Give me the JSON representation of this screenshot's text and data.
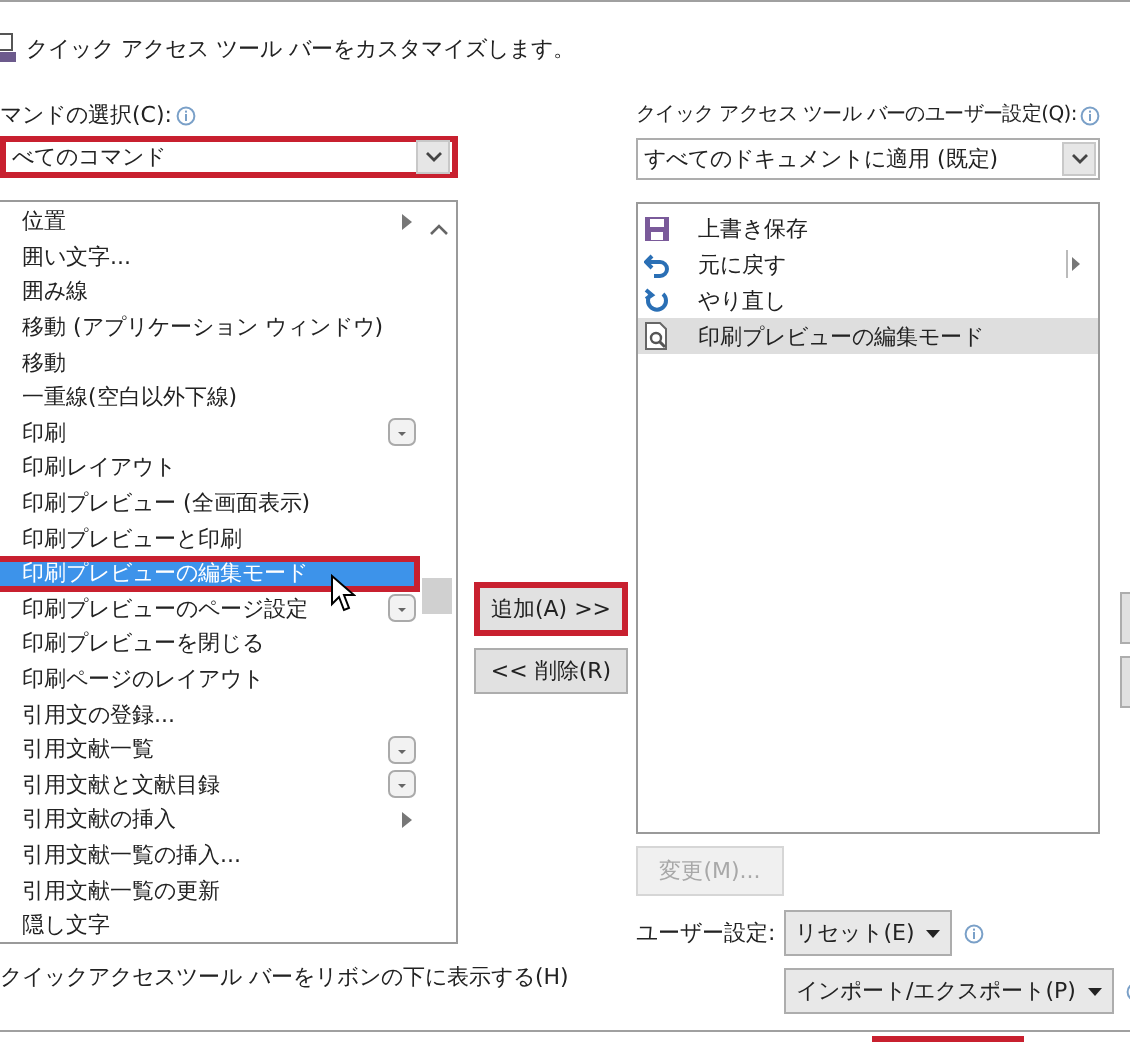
{
  "title": "クイック アクセス ツール バーをカスタマイズします。",
  "commands": {
    "label": "マンドの選択(C):",
    "value": "べてのコマンド",
    "highlighted": true,
    "items": [
      {
        "label": "位置",
        "submenu": true,
        "dropdown": false,
        "selected": false
      },
      {
        "label": "囲い文字...",
        "submenu": false,
        "dropdown": false,
        "selected": false
      },
      {
        "label": "囲み線",
        "submenu": false,
        "dropdown": false,
        "selected": false
      },
      {
        "label": "移動 (アプリケーション ウィンドウ)",
        "submenu": false,
        "dropdown": false,
        "selected": false
      },
      {
        "label": "移動",
        "submenu": false,
        "dropdown": false,
        "selected": false
      },
      {
        "label": "一重線(空白以外下線)",
        "submenu": false,
        "dropdown": false,
        "selected": false
      },
      {
        "label": "印刷",
        "submenu": false,
        "dropdown": true,
        "selected": false
      },
      {
        "label": "印刷レイアウト",
        "submenu": false,
        "dropdown": false,
        "selected": false
      },
      {
        "label": "印刷プレビュー (全画面表示)",
        "submenu": false,
        "dropdown": false,
        "selected": false
      },
      {
        "label": "印刷プレビューと印刷",
        "submenu": false,
        "dropdown": false,
        "selected": false
      },
      {
        "label": "印刷プレビューの編集モード",
        "submenu": false,
        "dropdown": false,
        "selected": true
      },
      {
        "label": "印刷プレビューのページ設定",
        "submenu": false,
        "dropdown": true,
        "selected": false
      },
      {
        "label": "印刷プレビューを閉じる",
        "submenu": false,
        "dropdown": false,
        "selected": false
      },
      {
        "label": "印刷ページのレイアウト",
        "submenu": false,
        "dropdown": false,
        "selected": false
      },
      {
        "label": "引用文の登録...",
        "submenu": false,
        "dropdown": false,
        "selected": false
      },
      {
        "label": "引用文献一覧",
        "submenu": false,
        "dropdown": true,
        "selected": false
      },
      {
        "label": "引用文献と文献目録",
        "submenu": false,
        "dropdown": true,
        "selected": false
      },
      {
        "label": "引用文献の挿入",
        "submenu": true,
        "dropdown": false,
        "selected": false
      },
      {
        "label": "引用文献一覧の挿入...",
        "submenu": false,
        "dropdown": false,
        "selected": false
      },
      {
        "label": "引用文献一覧の更新",
        "submenu": false,
        "dropdown": false,
        "selected": false
      },
      {
        "label": "隠し文字",
        "submenu": false,
        "dropdown": false,
        "selected": false
      }
    ]
  },
  "add_button": {
    "label": "追加(A) >>",
    "highlighted": true
  },
  "remove_button": {
    "label": "<< 削除(R)"
  },
  "toolbar": {
    "label": "クイック アクセス ツール バーのユーザー設定(Q):",
    "value": "すべてのドキュメントに適用 (既定)",
    "items": [
      {
        "label": "上書き保存",
        "kind": "save",
        "submenu": false,
        "selected": false
      },
      {
        "label": "元に戻す",
        "kind": "undo",
        "submenu": true,
        "selected": false
      },
      {
        "label": "やり直し",
        "kind": "redo",
        "submenu": false,
        "selected": false
      },
      {
        "label": "印刷プレビューの編集モード",
        "kind": "preview",
        "submenu": false,
        "selected": true
      }
    ]
  },
  "modify_button": {
    "label": "変更(M)...",
    "disabled": true
  },
  "customize_label": "ユーザー設定:",
  "reset_button": {
    "label": "リセット(E)"
  },
  "import_button": {
    "label": "インポート/エクスポート(P)"
  },
  "show_below_ribbon": "クイックアクセスツール バーをリボンの下に表示する(H)"
}
